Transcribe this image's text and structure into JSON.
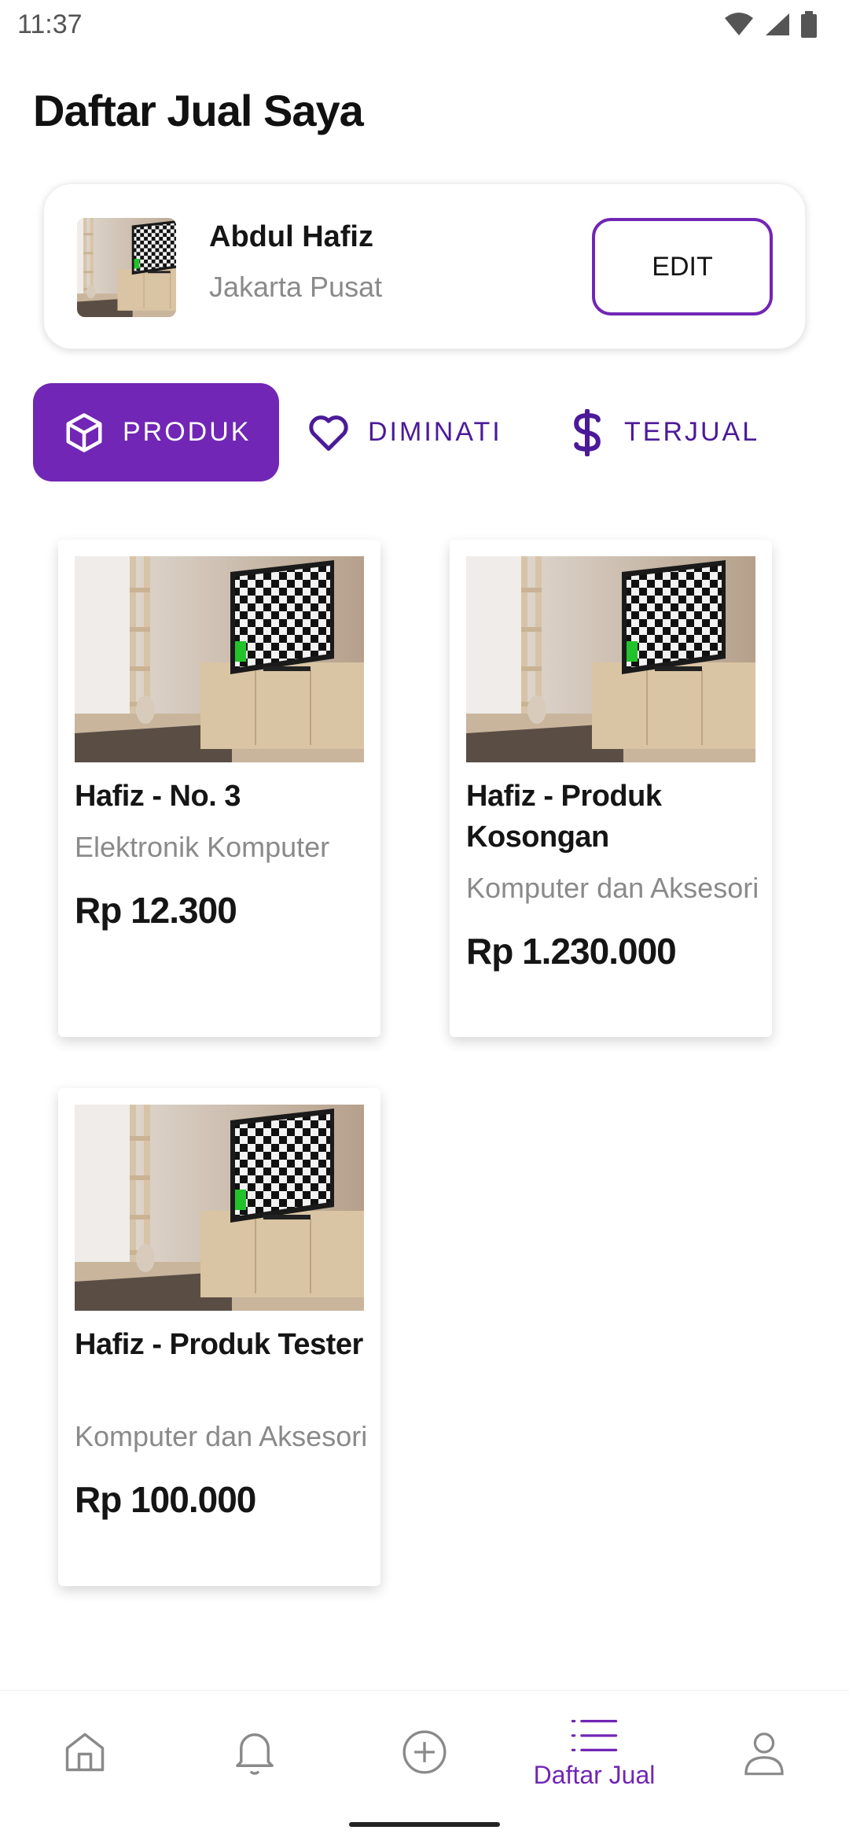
{
  "status_bar": {
    "time": "11:37"
  },
  "page": {
    "title": "Daftar Jual Saya"
  },
  "seller": {
    "name": "Abdul Hafiz",
    "city": "Jakarta Pusat",
    "edit_label": "EDIT"
  },
  "tabs": [
    {
      "label": "PRODUK",
      "icon": "box-icon",
      "active": true
    },
    {
      "label": "DIMINATI",
      "icon": "heart-icon",
      "active": false
    },
    {
      "label": "TERJUAL",
      "icon": "dollar-icon",
      "active": false
    }
  ],
  "products": [
    {
      "name": "Hafiz - No. 3",
      "category": "Elektronik Komputer",
      "price": "Rp 12.300"
    },
    {
      "name": "Hafiz - Produk Kosongan",
      "category": "Komputer dan Aksesoris",
      "price": "Rp 1.230.000"
    },
    {
      "name": "Hafiz - Produk Tester",
      "category": "Komputer dan Aksesoris",
      "price": "Rp 100.000"
    }
  ],
  "bottom_nav": [
    {
      "icon": "home-icon",
      "label": ""
    },
    {
      "icon": "bell-icon",
      "label": ""
    },
    {
      "icon": "plus-circle-icon",
      "label": ""
    },
    {
      "icon": "list-icon",
      "label": "Daftar Jual",
      "active": true
    },
    {
      "icon": "user-icon",
      "label": ""
    }
  ],
  "colors": {
    "accent": "#7126b5",
    "tab_text": "#4b1a99",
    "muted": "#8a8a8a"
  }
}
